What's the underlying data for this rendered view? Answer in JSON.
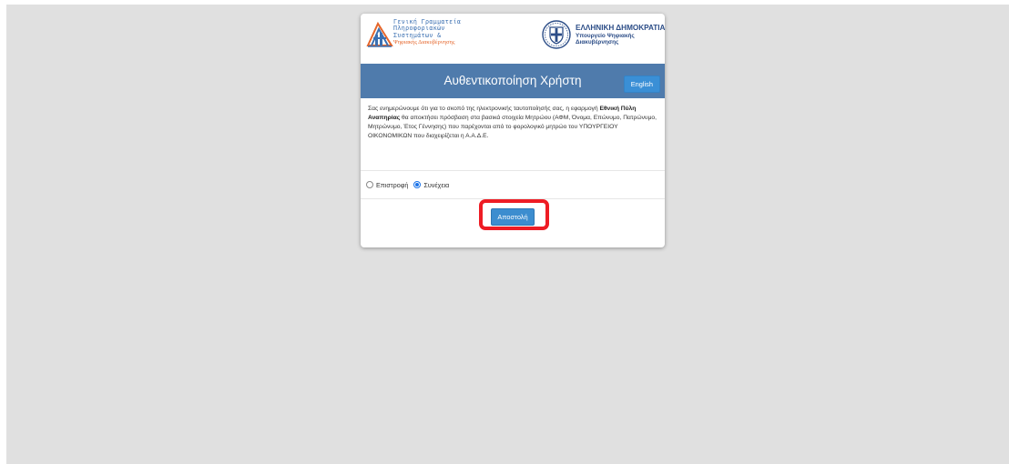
{
  "logos": {
    "gsis": {
      "lines": [
        "Γενική Γραμματεία",
        "Πληροφοριακών",
        "Συστημάτων &"
      ],
      "line_orange": "Ψηφιακής Διακυβέρνησης",
      "icon": "gsis-logo-icon"
    },
    "gov": {
      "title": "ΕΛΛΗΝΙΚΗ ΔΗΜΟΚΡΑΤΙΑ",
      "sub1": "Υπουργείο Ψηφιακής",
      "sub2": "Διακυβέρνησης",
      "icon": "greek-coat-of-arms-icon"
    }
  },
  "header": {
    "title": "Αυθεντικοποίηση Χρήστη",
    "language_button": "English"
  },
  "notice": {
    "part1": "Σας ενημερώνουμε ότι για το σκοπό της ηλεκτρονικής ταυτοποίησής σας, η εφαρμογή ",
    "app_name": "Εθνική Πύλη Αναπηρίας",
    "part2": " θα αποκτήσει πρόσβαση στα βασικά στοιχεία Μητρώου (ΑΦΜ, Όνομα, Επώνυμο, Πατρώνυμο, Μητρώνυμο, Έτος Γέννησης) που παρέχονται από το φορολογικό μητρώο του ΥΠΟΥΡΓΕΙΟΥ ΟΙΚΟΝΟΜΙΚΩΝ που διαχειρίζεται η Α.Α.Δ.Ε."
  },
  "options": {
    "back_label": "Επιστροφή",
    "continue_label": "Συνέχεια",
    "selected": "Συνέχεια"
  },
  "submit": {
    "label": "Αποστολή"
  },
  "colors": {
    "header_bar": "#4f7bac",
    "button_blue": "#3c8dcf",
    "highlight_red": "#ee1c24",
    "background": "#e0e0e0"
  }
}
